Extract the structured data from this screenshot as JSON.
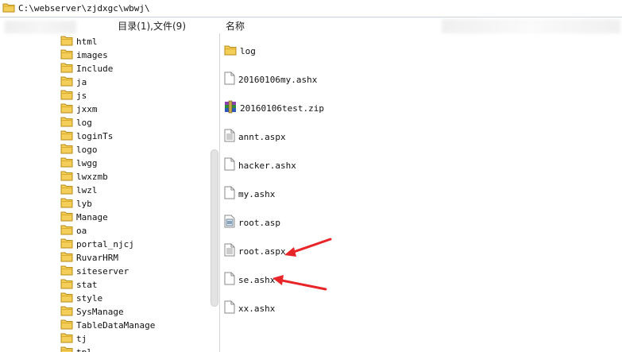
{
  "path": "C:\\webserver\\zjdxgc\\wbwj\\",
  "left_header": "目录(1),文件(9)",
  "right_header": "名称",
  "tree": [
    "html",
    "images",
    "Include",
    "ja",
    "js",
    "jxxm",
    "log",
    "loginTs",
    "logo",
    "lwgg",
    "lwxzmb",
    "lwzl",
    "lyb",
    "Manage",
    "oa",
    "portal_njcj",
    "RuvarHRM",
    "siteserver",
    "stat",
    "style",
    "SysManage",
    "TableDataManage",
    "tj",
    "tpl"
  ],
  "files": [
    {
      "name": "log",
      "icon": "folder-icon"
    },
    {
      "name": "20160106my.ashx",
      "icon": "file-icon"
    },
    {
      "name": "20160106test.zip",
      "icon": "zip-archive-icon"
    },
    {
      "name": "annt.aspx",
      "icon": "text-file-icon"
    },
    {
      "name": "hacker.ashx",
      "icon": "file-icon"
    },
    {
      "name": "my.ashx",
      "icon": "file-icon"
    },
    {
      "name": "root.asp",
      "icon": "script-file-icon"
    },
    {
      "name": "root.aspx",
      "icon": "text-file-icon"
    },
    {
      "name": "se.ashx",
      "icon": "file-icon"
    },
    {
      "name": "xx.ashx",
      "icon": "file-icon"
    }
  ],
  "colors": {
    "folder": "#f1c84b",
    "arrow": "#e8262a"
  }
}
